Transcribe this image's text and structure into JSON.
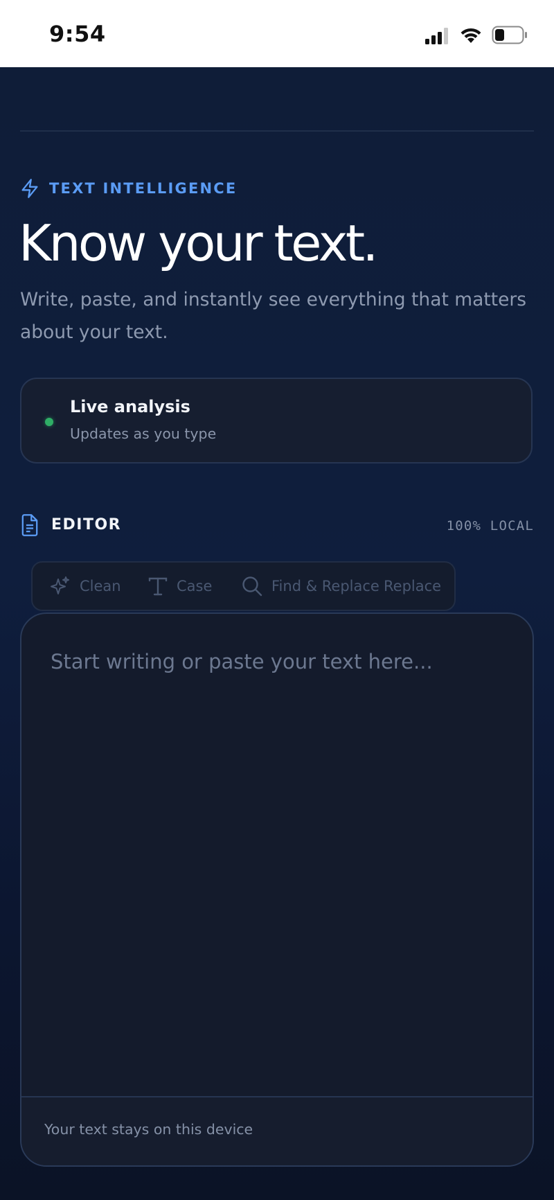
{
  "status_bar": {
    "time": "9:54",
    "icons": [
      "cellular-signal-icon",
      "wifi-icon",
      "battery-icon"
    ]
  },
  "hero": {
    "eyebrow_icon": "lightning-icon",
    "eyebrow": "TEXT INTELLIGENCE",
    "title": "Know your text.",
    "subtitle": "Write, paste, and instantly see everything that matters about your text."
  },
  "live_card": {
    "status_color": "#2fae66",
    "title": "Live analysis",
    "subtitle": "Updates as you type"
  },
  "editor": {
    "icon": "document-icon",
    "label": "EDITOR",
    "locality": "100% LOCAL",
    "toolbar": [
      {
        "icon": "sparkle-icon",
        "label": "Clean"
      },
      {
        "icon": "text-case-icon",
        "label": "Case"
      },
      {
        "icon": "search-icon",
        "label": "Find & Replace"
      },
      {
        "icon": "",
        "label": "Replace"
      }
    ],
    "placeholder": "Start writing or paste your text here...",
    "footer_note": "Your text stays on this device"
  },
  "colors": {
    "accent": "#5b9cf5",
    "background": "#0f1d38",
    "card": "#161e30"
  }
}
